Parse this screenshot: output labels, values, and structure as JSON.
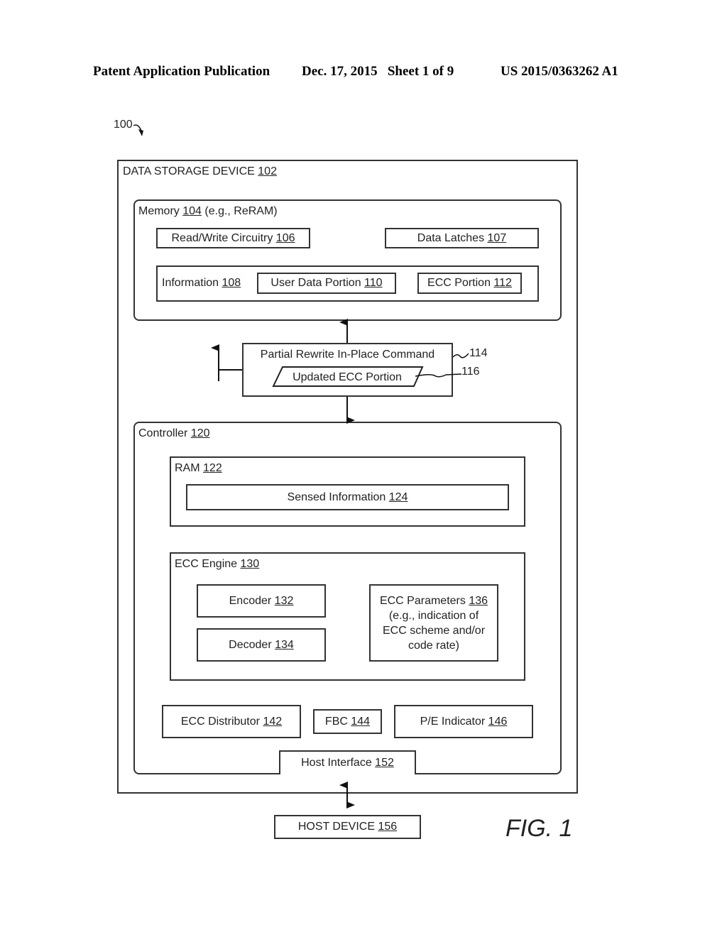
{
  "header": {
    "publication": "Patent Application Publication",
    "date_sheet": "Dec. 17, 2015   Sheet 1 of 9",
    "number": "US 2015/0363262 A1"
  },
  "figure": {
    "ref_system": "100",
    "label": "FIG. 1"
  },
  "blocks": {
    "data_storage_device": {
      "name": "DATA STORAGE DEVICE",
      "ref": "102"
    },
    "memory": {
      "name": "Memory",
      "ref": "104",
      "suffix": "(e.g., ReRAM)"
    },
    "rw_circuitry": {
      "name": "Read/Write Circuitry",
      "ref": "106"
    },
    "data_latches": {
      "name": "Data Latches",
      "ref": "107"
    },
    "information": {
      "name": "Information",
      "ref": "108"
    },
    "user_data_portion": {
      "name": "User Data Portion",
      "ref": "110"
    },
    "ecc_portion": {
      "name": "ECC Portion",
      "ref": "112"
    },
    "partial_rewrite_cmd": {
      "name": "Partial Rewrite In-Place Command",
      "ref": "114"
    },
    "updated_ecc_portion": {
      "name": "Updated ECC Portion",
      "ref": "116"
    },
    "controller": {
      "name": "Controller",
      "ref": "120"
    },
    "ram": {
      "name": "RAM",
      "ref": "122"
    },
    "sensed_information": {
      "name": "Sensed Information",
      "ref": "124"
    },
    "ecc_engine": {
      "name": "ECC Engine",
      "ref": "130"
    },
    "encoder": {
      "name": "Encoder",
      "ref": "132"
    },
    "decoder": {
      "name": "Decoder",
      "ref": "134"
    },
    "ecc_parameters": {
      "name": "ECC Parameters",
      "ref": "136",
      "line2": "(e.g., indication of",
      "line3": "ECC scheme and/or",
      "line4": "code rate)"
    },
    "ecc_distributor": {
      "name": "ECC Distributor",
      "ref": "142"
    },
    "fbc": {
      "name": "FBC",
      "ref": "144"
    },
    "pe_indicator": {
      "name": "P/E Indicator",
      "ref": "146"
    },
    "host_interface": {
      "name": "Host Interface",
      "ref": "152"
    },
    "host_device": {
      "name": "HOST DEVICE",
      "ref": "156"
    }
  }
}
